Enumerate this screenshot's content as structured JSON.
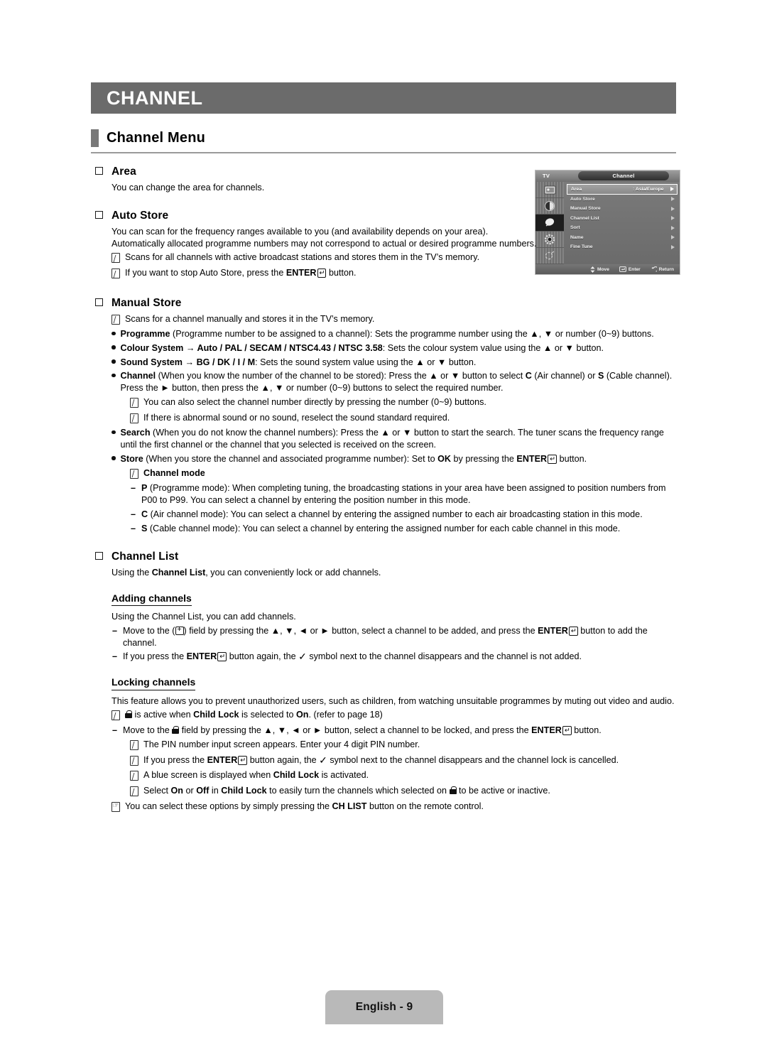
{
  "header": {
    "chapter_title": "CHANNEL",
    "section_title": "Channel Menu"
  },
  "sections": {
    "area": {
      "heading": "Area",
      "body": "You can change the area for channels."
    },
    "auto_store": {
      "heading": "Auto Store",
      "body": "You can scan for the frequency ranges available to you (and availability depends on your area). Automatically allocated programme numbers may not correspond to actual or desired programme numbers.",
      "note1": "Scans for all channels with active broadcast stations and stores them in the TV’s memory.",
      "note2_pre": "If you want to stop Auto Store, press the ",
      "note2_key": "ENTER",
      "note2_post": " button."
    },
    "manual_store": {
      "heading": "Manual Store",
      "note1": "Scans for a channel manually and stores it in the TV’s memory.",
      "bullet_programme_b": "Programme",
      "bullet_programme_t": " (Programme number to be assigned to a channel): Sets the programme number using the ▲, ▼ or number (0~9) buttons.",
      "bullet_colour_b": "Colour System → Auto / PAL / SECAM / NTSC4.43 / NTSC 3.58",
      "bullet_colour_t": ": Sets the colour system value using the ▲ or ▼ button.",
      "bullet_sound_b": "Sound System → BG / DK / I / M",
      "bullet_sound_t": ": Sets the sound system value using the ▲ or ▼ button.",
      "bullet_channel_b": "Channel",
      "bullet_channel_t1": " (When you know the number of the channel to be stored): Press the ▲ or ▼ button to select ",
      "bullet_channel_c": "C",
      "bullet_channel_t2": " (Air channel) or ",
      "bullet_channel_s": "S",
      "bullet_channel_t3": " (Cable channel). Press the ► button, then press the ▲, ▼ or number (0~9) buttons to select the required number.",
      "sub_note1": "You can also select the channel number directly by pressing the number (0~9) buttons.",
      "sub_note2": "If there is abnormal sound or no sound, reselect the sound standard required.",
      "bullet_search_b": "Search",
      "bullet_search_t": " (When you do not know the channel numbers): Press the ▲ or ▼ button to start the search. The tuner scans the frequency range until the first channel or the channel that you selected is received on the screen.",
      "bullet_store_b": "Store",
      "bullet_store_t1": " (When you store the channel and associated programme number): Set to ",
      "bullet_store_ok": "OK",
      "bullet_store_t2": " by pressing the ",
      "bullet_store_key": "ENTER",
      "bullet_store_t3": " button.",
      "channel_mode_label": "Channel mode",
      "mode_p_b": "P",
      "mode_p_t": " (Programme mode): When completing tuning, the broadcasting stations in your area have been assigned to position numbers from P00 to P99. You can select a channel by entering the position number in this mode.",
      "mode_c_b": "C",
      "mode_c_t": " (Air channel mode): You can select a channel by entering the assigned number to each air broadcasting station in this mode.",
      "mode_s_b": "S",
      "mode_s_t": " (Cable channel mode): You can select a channel by entering the assigned number for each cable channel in this mode."
    },
    "channel_list": {
      "heading": "Channel List",
      "body_pre": "Using the ",
      "body_b": "Channel List",
      "body_post": ", you can conveniently lock or add channels.",
      "adding_heading": "Adding channels",
      "adding_body": "Using the Channel List, you can add channels.",
      "adding_d1_a": "Move to the (",
      "adding_d1_b": ") field by pressing the ▲, ▼, ◄ or ► button, select a channel to be added, and press the ",
      "adding_d1_key": "ENTER",
      "adding_d1_c": " button to add the channel.",
      "adding_d2_a": "If you press the ",
      "adding_d2_key": "ENTER",
      "adding_d2_b": " button again, the ",
      "adding_d2_c": " symbol next to the channel disappears and the channel is not added.",
      "locking_heading": "Locking channels",
      "locking_body": "This feature allows you to prevent unauthorized users, such as children, from watching unsuitable programmes by muting out video and audio.",
      "lock_n1_a": " is active when ",
      "lock_n1_b": "Child Lock",
      "lock_n1_c": " is selected to ",
      "lock_n1_d": "On",
      "lock_n1_e": ". (refer to page 18)",
      "lock_d1_a": "Move to the ",
      "lock_d1_b": " field by pressing the ▲, ▼, ◄ or ► button, select a channel to be locked, and press the ",
      "lock_d1_key": "ENTER",
      "lock_d1_c": " button.",
      "lock_n2": "The PIN number input screen appears. Enter your 4 digit PIN number.",
      "lock_n3_a": "If you press the ",
      "lock_n3_key": "ENTER",
      "lock_n3_b": " button again, the ",
      "lock_n3_c": " symbol next to the channel disappears and the channel lock is cancelled.",
      "lock_n4_a": "A blue screen is displayed when ",
      "lock_n4_b": "Child Lock",
      "lock_n4_c": " is activated.",
      "lock_n5_a": "Select ",
      "lock_n5_on": "On",
      "lock_n5_b": " or ",
      "lock_n5_off": "Off",
      "lock_n5_c": " in ",
      "lock_n5_d": "Child Lock",
      "lock_n5_e": " to easily turn the channels which selected on ",
      "lock_n5_f": " to be active or inactive.",
      "hand_note_a": "You can select these options by simply pressing the ",
      "hand_note_b": "CH LIST",
      "hand_note_c": " button on the remote control."
    }
  },
  "osd": {
    "source_label": "TV",
    "tab_label": "Channel",
    "rows": [
      {
        "name": "Area",
        "value": ": Asia/Europe",
        "selected": true
      },
      {
        "name": "Auto Store",
        "value": "",
        "selected": false
      },
      {
        "name": "Manual Store",
        "value": "",
        "selected": false
      },
      {
        "name": "Channel List",
        "value": "",
        "selected": false
      },
      {
        "name": "Sort",
        "value": "",
        "selected": false
      },
      {
        "name": "Name",
        "value": "",
        "selected": false
      },
      {
        "name": "Fine Tune",
        "value": "",
        "selected": false
      }
    ],
    "hints": [
      {
        "icon": "updown-icon",
        "label": "Move"
      },
      {
        "icon": "enter-icon",
        "label": "Enter"
      },
      {
        "icon": "return-icon",
        "label": "Return"
      }
    ],
    "side_icons": [
      "picture-icon",
      "sound-icon",
      "channel-icon",
      "setup-icon",
      "input-icon"
    ]
  },
  "footer": {
    "page_label": "English - 9"
  },
  "colors": {
    "chapter_bar": "#6b6b6b",
    "accent_square": "#787878",
    "rule": "#9a9a9a",
    "footer_tab": "#b9b9b9"
  }
}
